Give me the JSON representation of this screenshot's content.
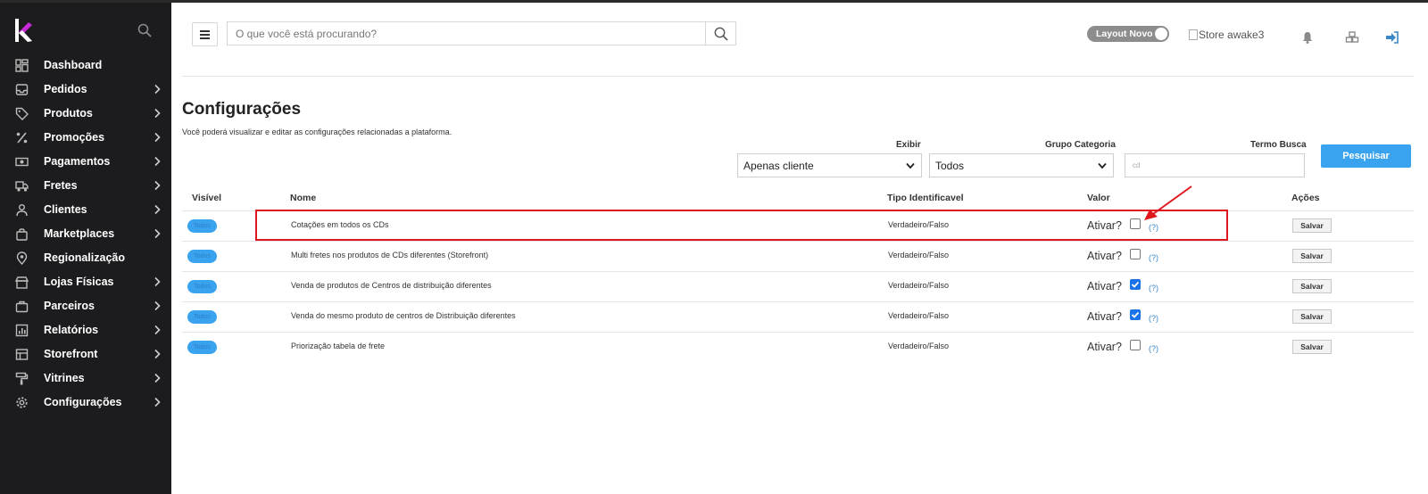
{
  "sidebar": {
    "items": [
      {
        "label": "Dashboard",
        "icon": "dashboard-icon",
        "has_children": false
      },
      {
        "label": "Pedidos",
        "icon": "inbox-icon",
        "has_children": true
      },
      {
        "label": "Produtos",
        "icon": "tag-icon",
        "has_children": true
      },
      {
        "label": "Promoções",
        "icon": "percent-icon",
        "has_children": true
      },
      {
        "label": "Pagamentos",
        "icon": "money-icon",
        "has_children": true
      },
      {
        "label": "Fretes",
        "icon": "truck-icon",
        "has_children": true
      },
      {
        "label": "Clientes",
        "icon": "user-icon",
        "has_children": true
      },
      {
        "label": "Marketplaces",
        "icon": "shopping-bag-icon",
        "has_children": true
      },
      {
        "label": "Regionalização",
        "icon": "map-pin-icon",
        "has_children": false
      },
      {
        "label": "Lojas Físicas",
        "icon": "store-icon",
        "has_children": true
      },
      {
        "label": "Parceiros",
        "icon": "briefcase-icon",
        "has_children": true
      },
      {
        "label": "Relatórios",
        "icon": "report-icon",
        "has_children": true
      },
      {
        "label": "Storefront",
        "icon": "storefront-icon",
        "has_children": true
      },
      {
        "label": "Vitrines",
        "icon": "paint-roller-icon",
        "has_children": true
      },
      {
        "label": "Configurações",
        "icon": "gear-icon",
        "has_children": true
      }
    ]
  },
  "header": {
    "search_placeholder": "O que você está procurando?",
    "layout_toggle_label": "Layout Novo",
    "store_image_alt": "Store awake3"
  },
  "page": {
    "title": "Configurações",
    "subtitle": "Você poderá visualizar e editar as configurações relacionadas a plataforma."
  },
  "filters": {
    "exibir_label": "Exibir",
    "exibir_value": "Apenas cliente",
    "grupo_label": "Grupo Categoria",
    "grupo_value": "Todos",
    "termo_label": "Termo Busca",
    "termo_placeholder": "cd",
    "search_button": "Pesquisar"
  },
  "table": {
    "headers": {
      "visivel": "Visível",
      "nome": "Nome",
      "tipo": "Tipo Identificavel",
      "valor": "Valor",
      "acoes": "Ações"
    },
    "rows": [
      {
        "visivel": "Todos",
        "nome": "Cotações em todos os CDs",
        "tipo": "Verdadeiro/Falso",
        "ativar": "Ativar?",
        "checked": false,
        "help": "(?)",
        "action": "Salvar"
      },
      {
        "visivel": "Todos",
        "nome": "Multi fretes nos produtos de CDs diferentes (Storefront)",
        "tipo": "Verdadeiro/Falso",
        "ativar": "Ativar?",
        "checked": false,
        "help": "(?)",
        "action": "Salvar"
      },
      {
        "visivel": "Todos",
        "nome": "Venda de produtos de Centros de distribuição diferentes",
        "tipo": "Verdadeiro/Falso",
        "ativar": "Ativar?",
        "checked": true,
        "help": "(?)",
        "action": "Salvar"
      },
      {
        "visivel": "Todos",
        "nome": "Venda do mesmo produto de centros de Distribuição diferentes",
        "tipo": "Verdadeiro/Falso",
        "ativar": "Ativar?",
        "checked": true,
        "help": "(?)",
        "action": "Salvar"
      },
      {
        "visivel": "Todos",
        "nome": "Priorização tabela de frete",
        "tipo": "Verdadeiro/Falso",
        "ativar": "Ativar?",
        "checked": false,
        "help": "(?)",
        "action": "Salvar"
      }
    ]
  },
  "colors": {
    "sidebar_bg": "#1c1c1f",
    "accent": "#3aa3f0",
    "highlight": "#e0161e",
    "checkbox_on": "#1a73e8"
  }
}
